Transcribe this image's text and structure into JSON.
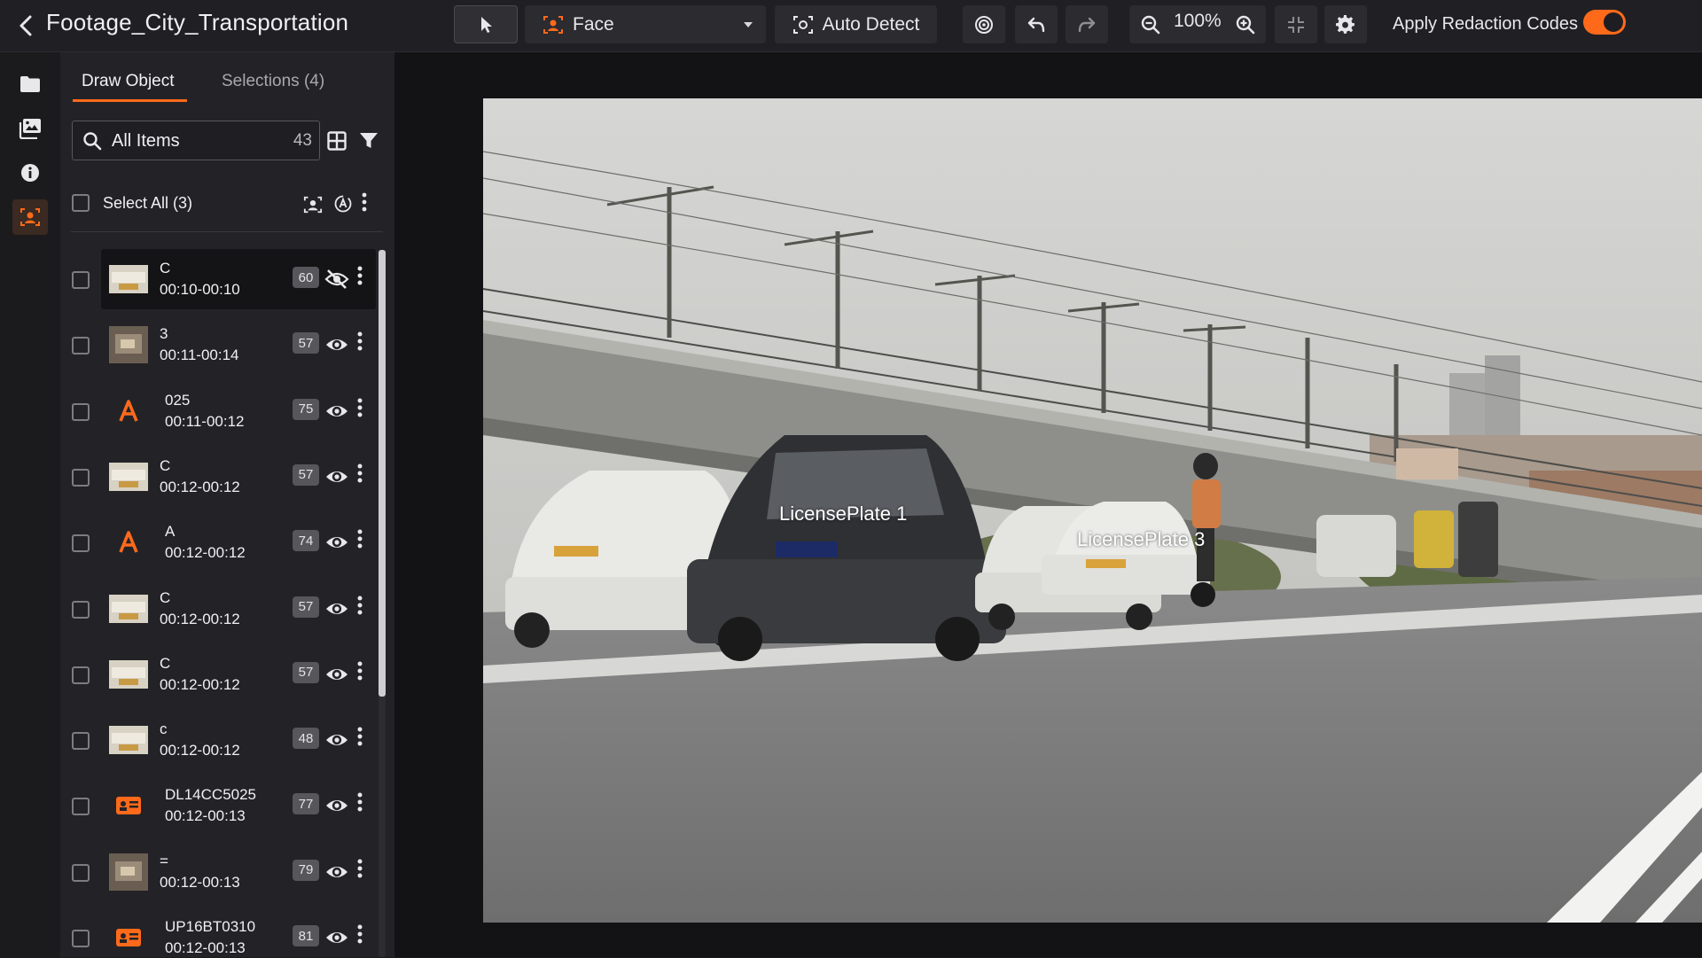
{
  "header": {
    "title": "Footage_City_Transportation",
    "tool_select": "Face",
    "auto_detect_label": "Auto Detect",
    "zoom": "100%",
    "apply_redaction_label": "Apply Redaction Codes",
    "apply_redaction_on": true
  },
  "panel": {
    "tabs": [
      {
        "label": "Draw Object",
        "active": true
      },
      {
        "label": "Selections (4)",
        "active": false
      }
    ],
    "search": {
      "placeholder": "All Items",
      "count": "43"
    },
    "select_all_label": "Select All (3)",
    "items": [
      {
        "name": "C",
        "time": "00:10-00:10",
        "score": "60",
        "visible": false,
        "thumb": "car",
        "selected": true
      },
      {
        "name": "3",
        "time": "00:11-00:14",
        "score": "57",
        "visible": true,
        "thumb": "sign"
      },
      {
        "name": "025",
        "time": "00:11-00:12",
        "score": "75",
        "visible": true,
        "thumb": "text-A"
      },
      {
        "name": "C",
        "time": "00:12-00:12",
        "score": "57",
        "visible": true,
        "thumb": "car"
      },
      {
        "name": "A",
        "time": "00:12-00:12",
        "score": "74",
        "visible": true,
        "thumb": "text-A"
      },
      {
        "name": "C",
        "time": "00:12-00:12",
        "score": "57",
        "visible": true,
        "thumb": "car"
      },
      {
        "name": "C",
        "time": "00:12-00:12",
        "score": "57",
        "visible": true,
        "thumb": "car"
      },
      {
        "name": "c",
        "time": "00:12-00:12",
        "score": "48",
        "visible": true,
        "thumb": "car"
      },
      {
        "name": "DL14CC5025",
        "time": "00:12-00:13",
        "score": "77",
        "visible": true,
        "thumb": "plate"
      },
      {
        "name": "=",
        "time": "00:12-00:13",
        "score": "79",
        "visible": true,
        "thumb": "sign"
      },
      {
        "name": "UP16BT0310",
        "time": "00:12-00:13",
        "score": "81",
        "visible": true,
        "thumb": "plate"
      }
    ]
  },
  "viewer": {
    "labels": [
      "LicensePlate 1",
      "LicensePlate 3"
    ]
  },
  "colors": {
    "accent": "#ff6a1a",
    "background": "#1b1b1d",
    "panel": "#232327"
  }
}
